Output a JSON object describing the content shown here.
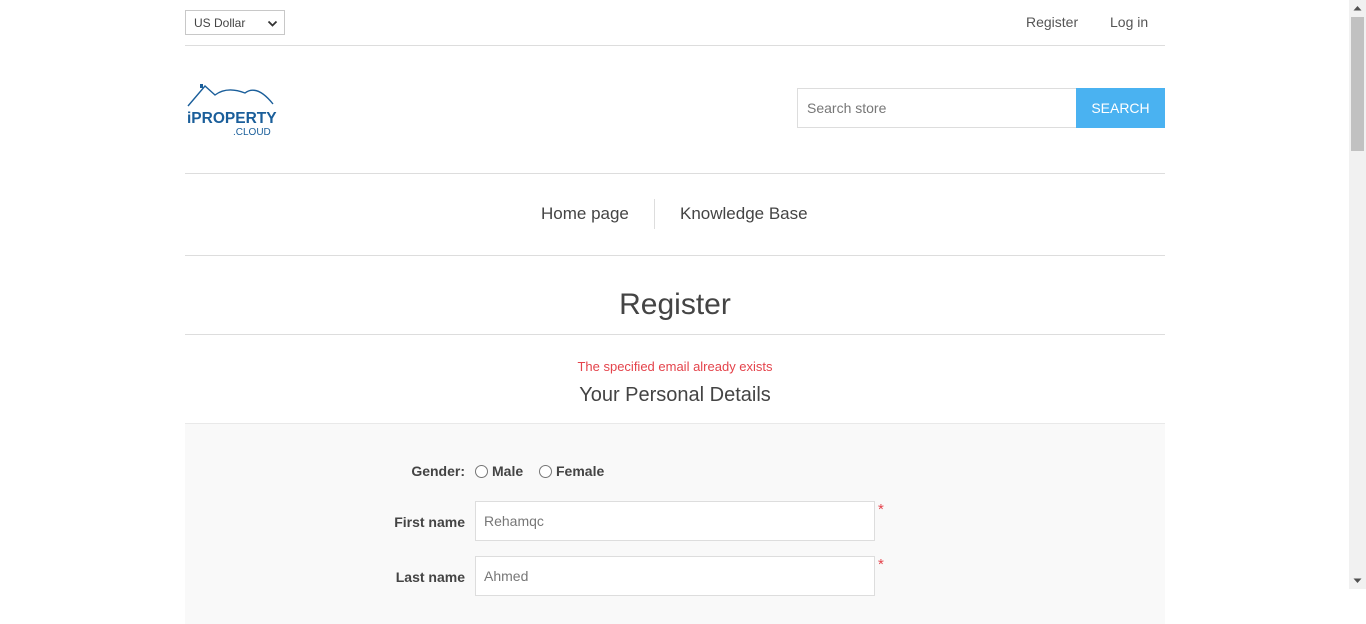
{
  "header": {
    "currency": "US Dollar",
    "register_link": "Register",
    "login_link": "Log in"
  },
  "logo": {
    "main": "iPROPERTY",
    "sub": ".CLOUD"
  },
  "search": {
    "placeholder": "Search store",
    "button_label": "SEARCH"
  },
  "menu": {
    "items": [
      {
        "label": "Home page"
      },
      {
        "label": "Knowledge Base"
      }
    ]
  },
  "page": {
    "title": "Register",
    "error_message": "The specified email already exists",
    "section_title": "Your Personal Details"
  },
  "form": {
    "gender_label": "Gender:",
    "gender_options": [
      "Male",
      "Female"
    ],
    "first_name_label": "First name",
    "first_name_value": "Rehamqc",
    "last_name_label": "Last name",
    "last_name_value": "Ahmed",
    "required_mark": "*"
  },
  "colors": {
    "accent": "#4ab2f1",
    "error": "#e4434b",
    "logo_blue": "#1a5e9a"
  }
}
